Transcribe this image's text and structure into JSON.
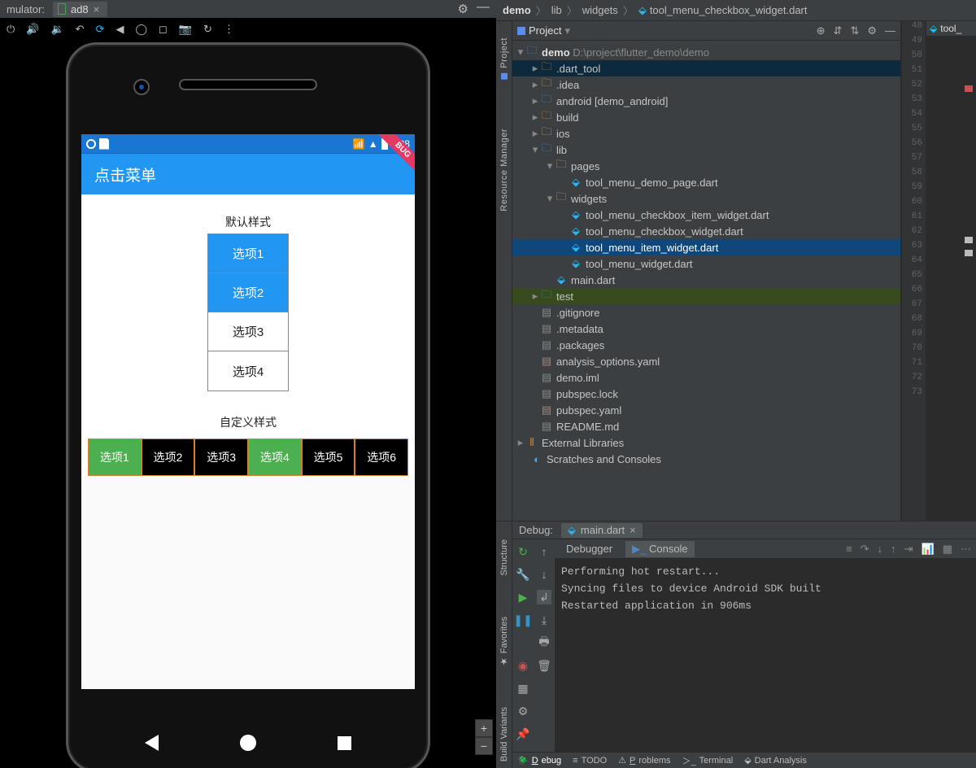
{
  "emulator": {
    "title": "mulator:",
    "device_tab": "ad8",
    "status_time": "6:28",
    "appbar_title": "点击菜单",
    "section1_title": "默认样式",
    "list1": [
      {
        "label": "选项1",
        "active": true
      },
      {
        "label": "选项2",
        "active": true
      },
      {
        "label": "选项3",
        "active": false
      },
      {
        "label": "选项4",
        "active": false
      }
    ],
    "section2_title": "自定义样式",
    "list2": [
      {
        "label": "选项1",
        "active": true
      },
      {
        "label": "选项2",
        "active": false
      },
      {
        "label": "选项3",
        "active": false
      },
      {
        "label": "选项4",
        "active": true
      },
      {
        "label": "选项5",
        "active": false
      },
      {
        "label": "选项6",
        "active": false
      }
    ],
    "debug_badge": "BUG"
  },
  "ide": {
    "breadcrumbs": [
      "demo",
      "lib",
      "widgets",
      "tool_menu_checkbox_widget.dart"
    ],
    "proj_label": "Project",
    "side_tabs": [
      "Project",
      "Resource Manager"
    ],
    "tree": {
      "root": {
        "name": "demo",
        "path": "D:\\project\\flutter_demo\\demo"
      },
      "items": [
        {
          "name": ".dart_tool",
          "type": "folder-orange",
          "indent": 1,
          "sel": true
        },
        {
          "name": ".idea",
          "type": "folder",
          "indent": 1
        },
        {
          "name": "android [demo_android]",
          "type": "folder-blue",
          "indent": 1
        },
        {
          "name": "build",
          "type": "folder-orange",
          "indent": 1
        },
        {
          "name": "ios",
          "type": "folder",
          "indent": 1
        },
        {
          "name": "lib",
          "type": "folder-blue",
          "indent": 1,
          "open": true
        },
        {
          "name": "pages",
          "type": "folder",
          "indent": 2,
          "open": true
        },
        {
          "name": "tool_menu_demo_page.dart",
          "type": "dart",
          "indent": 3
        },
        {
          "name": "widgets",
          "type": "folder",
          "indent": 2,
          "open": true
        },
        {
          "name": "tool_menu_checkbox_item_widget.dart",
          "type": "dart",
          "indent": 3
        },
        {
          "name": "tool_menu_checkbox_widget.dart",
          "type": "dart",
          "indent": 3
        },
        {
          "name": "tool_menu_item_widget.dart",
          "type": "dart",
          "indent": 3,
          "selActive": true
        },
        {
          "name": "tool_menu_widget.dart",
          "type": "dart",
          "indent": 3
        },
        {
          "name": "main.dart",
          "type": "dart",
          "indent": 2
        },
        {
          "name": "test",
          "type": "folder-blue",
          "indent": 1,
          "hl": true
        },
        {
          "name": ".gitignore",
          "type": "file",
          "indent": 1
        },
        {
          "name": ".metadata",
          "type": "file",
          "indent": 1
        },
        {
          "name": ".packages",
          "type": "file",
          "indent": 1
        },
        {
          "name": "analysis_options.yaml",
          "type": "yaml",
          "indent": 1
        },
        {
          "name": "demo.iml",
          "type": "file",
          "indent": 1
        },
        {
          "name": "pubspec.lock",
          "type": "file",
          "indent": 1
        },
        {
          "name": "pubspec.yaml",
          "type": "yaml",
          "indent": 1
        },
        {
          "name": "README.md",
          "type": "file",
          "indent": 1
        }
      ],
      "ext_lib": "External Libraries",
      "scratches": "Scratches and Consoles"
    },
    "gutter_start": 48,
    "gutter_end": 73,
    "editor_tab": "tool_",
    "debug": {
      "label": "Debug:",
      "run_tab": "main.dart",
      "sub_tabs": [
        "Debugger",
        "Console"
      ],
      "console_lines": [
        "Performing hot restart...",
        "Syncing files to device Android SDK built",
        "Restarted application in 906ms"
      ]
    },
    "statusline": [
      {
        "label": "Debug",
        "u": "D",
        "active": true,
        "icon": "bug"
      },
      {
        "label": "TODO",
        "u": "",
        "icon": "three"
      },
      {
        "label": "Problems",
        "u": "P",
        "icon": "warn"
      },
      {
        "label": "Terminal",
        "u": "",
        "icon": "term"
      },
      {
        "label": "Dart Analysis",
        "u": "",
        "icon": "dart"
      }
    ],
    "side_tabs_bottom": [
      "Structure",
      "Favorites",
      "Build Variants"
    ]
  }
}
